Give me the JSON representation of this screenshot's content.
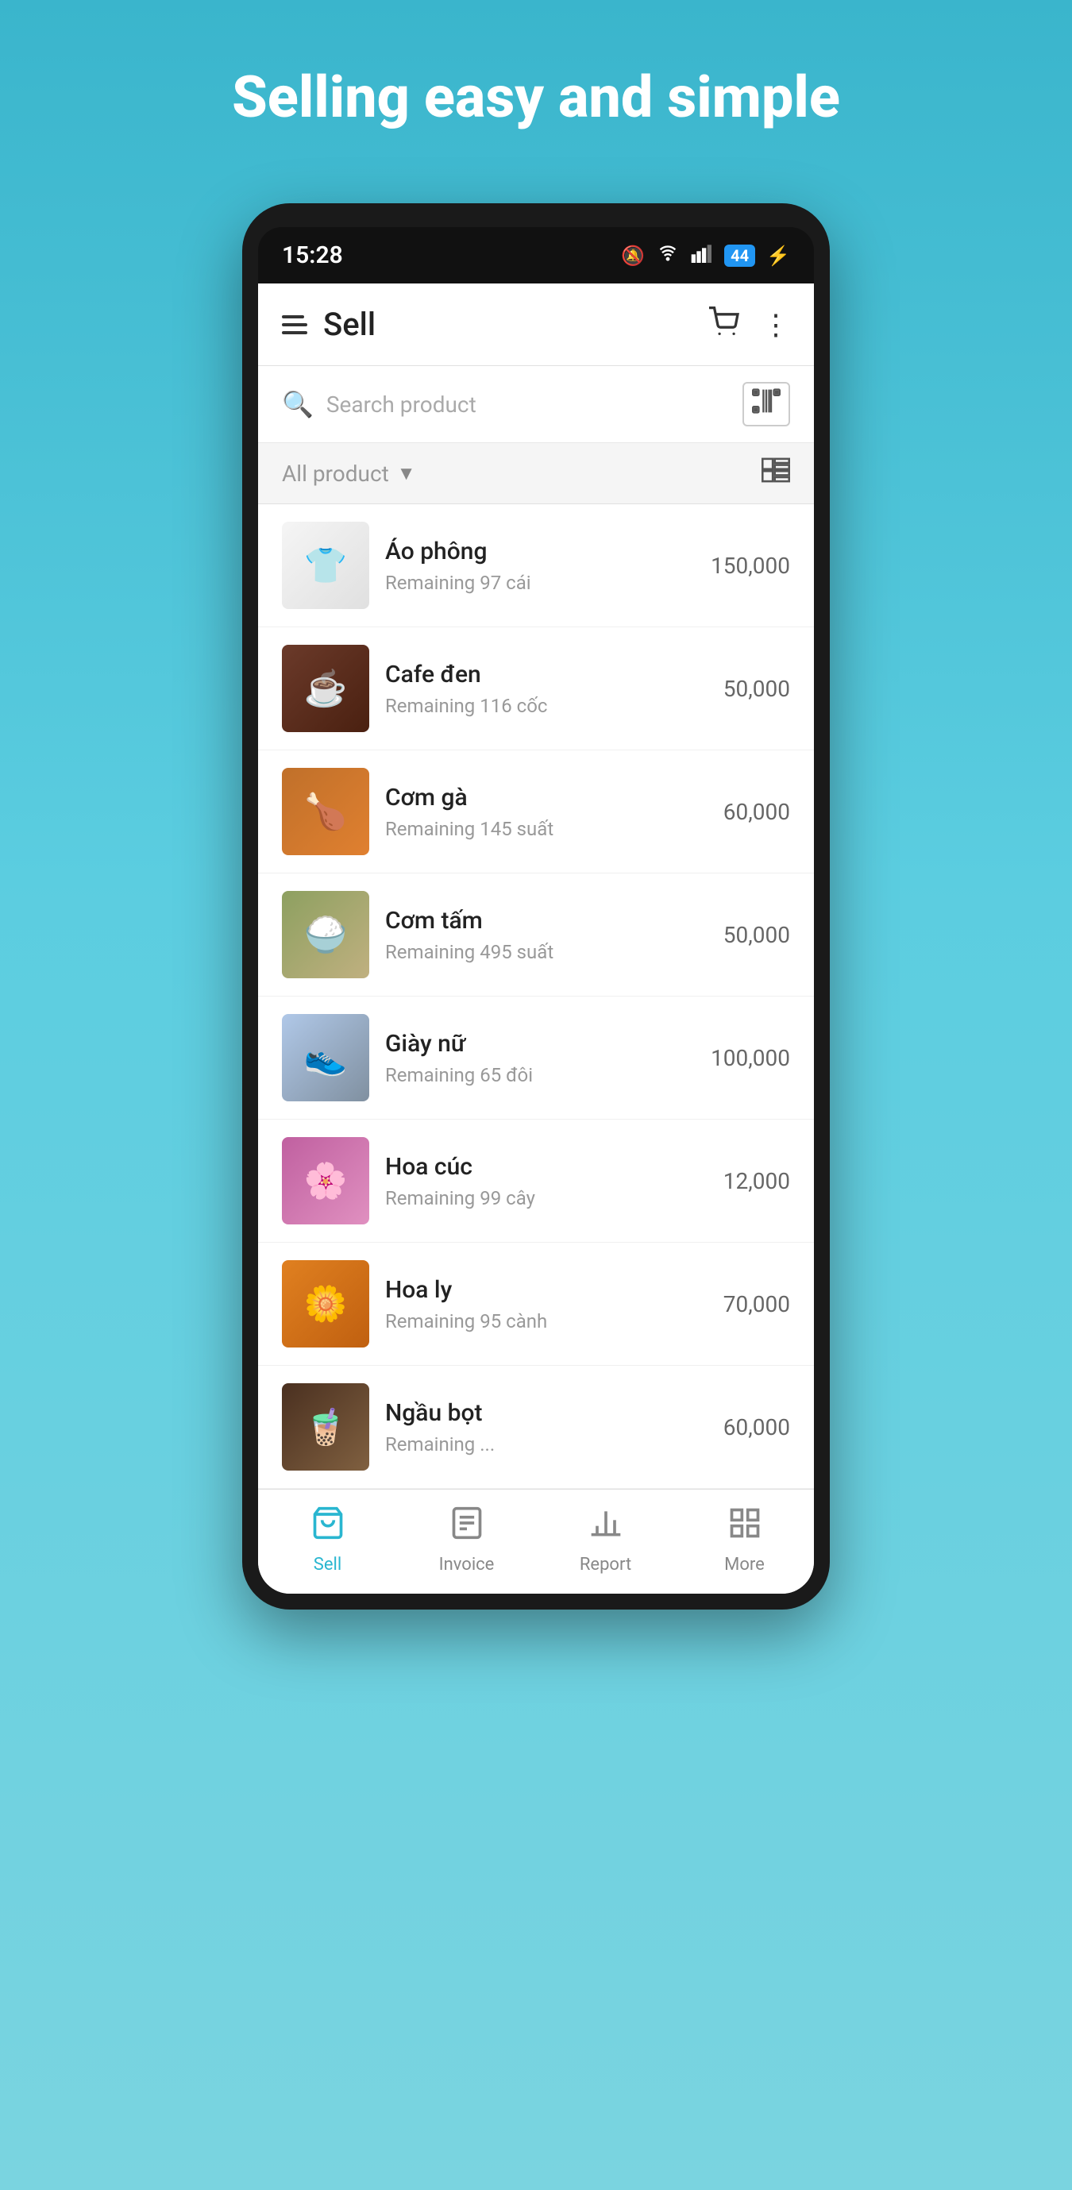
{
  "hero": {
    "title": "Selling easy and simple"
  },
  "status_bar": {
    "time": "15:28",
    "battery": "44",
    "icons": [
      "mute",
      "wifi",
      "signal",
      "battery",
      "charge"
    ]
  },
  "header": {
    "title": "Sell",
    "cart_label": "cart",
    "more_label": "more options"
  },
  "search": {
    "placeholder": "Search product"
  },
  "filter": {
    "label": "All product"
  },
  "products": [
    {
      "id": "ao-phong",
      "name": "Áo phông",
      "remaining": "Remaining 97 cái",
      "price": "150,000",
      "img_class": "img-ao-phong",
      "emoji": "👕"
    },
    {
      "id": "cafe-den",
      "name": "Cafe đen",
      "remaining": "Remaining 116 cốc",
      "price": "50,000",
      "img_class": "img-cafe",
      "emoji": "☕"
    },
    {
      "id": "com-ga",
      "name": "Cơm gà",
      "remaining": "Remaining 145 suất",
      "price": "60,000",
      "img_class": "img-com-ga",
      "emoji": "🍗"
    },
    {
      "id": "com-tam",
      "name": "Cơm tấm",
      "remaining": "Remaining 495 suất",
      "price": "50,000",
      "img_class": "img-com-tam",
      "emoji": "🍚"
    },
    {
      "id": "giay-nu",
      "name": "Giày nữ",
      "remaining": "Remaining 65 đôi",
      "price": "100,000",
      "img_class": "img-giay-nu",
      "emoji": "👟"
    },
    {
      "id": "hoa-cuc",
      "name": "Hoa cúc",
      "remaining": "Remaining 99 cây",
      "price": "12,000",
      "img_class": "img-hoa-cuc",
      "emoji": "🌸"
    },
    {
      "id": "hoa-ly",
      "name": "Hoa ly",
      "remaining": "Remaining 95 cành",
      "price": "70,000",
      "img_class": "img-hoa-ly",
      "emoji": "🌼"
    },
    {
      "id": "ngau-bot",
      "name": "Ngầu bọt",
      "remaining": "Remaining ...",
      "price": "60,000",
      "img_class": "img-ngau-bot",
      "emoji": "🧋"
    }
  ],
  "bottom_nav": [
    {
      "id": "sell",
      "label": "Sell",
      "active": true
    },
    {
      "id": "invoice",
      "label": "Invoice",
      "active": false
    },
    {
      "id": "report",
      "label": "Report",
      "active": false
    },
    {
      "id": "more",
      "label": "More",
      "active": false
    }
  ]
}
